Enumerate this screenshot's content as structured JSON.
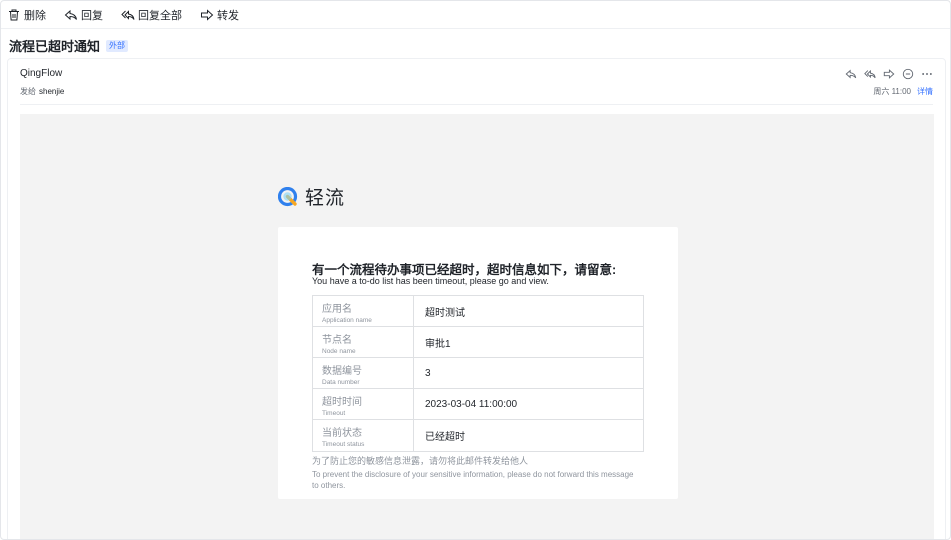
{
  "toolbar": {
    "delete_label": "删除",
    "reply_label": "回复",
    "reply_all_label": "回复全部",
    "forward_label": "转发",
    "icons": [
      "trash-icon",
      "reply-icon",
      "reply-all-icon",
      "forward-icon"
    ]
  },
  "subject": {
    "title": "流程已超时通知",
    "badge": "外部"
  },
  "mail": {
    "sender": "QingFlow",
    "to_prefix": "发给",
    "to_name": "shenjie",
    "date": "周六 11:00",
    "detail_link": "详情",
    "header_icons": [
      "reply-icon",
      "reply-all-icon",
      "forward-icon",
      "comment-icon",
      "more-icon"
    ]
  },
  "email": {
    "logo_text": "轻流",
    "heading_cn": "有一个流程待办事项已经超时，超时信息如下，请留意:",
    "heading_en": "You have a  to-do list has been timeout, please go and view.",
    "rows": [
      {
        "key_cn": "应用名",
        "key_en": "Application name",
        "value": "超时测试"
      },
      {
        "key_cn": "节点名",
        "key_en": "Node name",
        "value": "审批1"
      },
      {
        "key_cn": "数据编号",
        "key_en": "Data number",
        "value": "3"
      },
      {
        "key_cn": "超时时间",
        "key_en": "Timeout",
        "value": "2023-03-04 11:00:00"
      },
      {
        "key_cn": "当前状态",
        "key_en": "Timeout status",
        "value": "已经超时"
      }
    ],
    "notice_cn": "为了防止您的敏感信息泄露，请勿将此邮件转发给他人",
    "notice_en": "To prevent the disclosure of your sensitive information, please do not forward this message to others."
  },
  "colors": {
    "accent": "#3370ff",
    "badge_bg": "#e1eaff",
    "body_bg": "#f3f3f3",
    "logo_blue": "#2f80ed",
    "logo_orange": "#f5a623"
  }
}
